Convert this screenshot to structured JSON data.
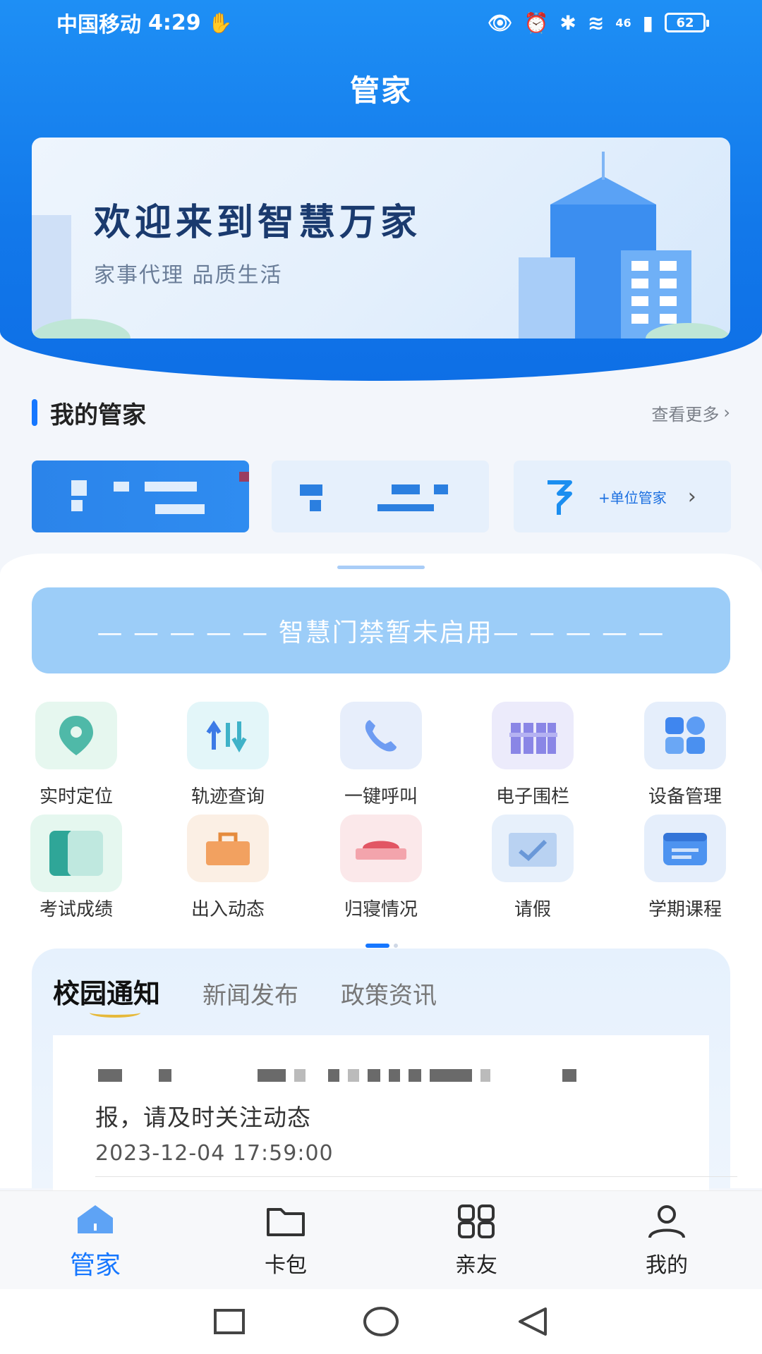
{
  "status": {
    "carrier": "中国移动",
    "time": "4:29",
    "network": "46",
    "battery": "62"
  },
  "header": {
    "title": "管家"
  },
  "banner": {
    "title": "欢迎来到智慧万家",
    "subtitle": "家事代理  品质生活"
  },
  "butler": {
    "title": "我的管家",
    "more": "查看更多",
    "add_unit": "+单位管家"
  },
  "door": {
    "text": "— — — — — 智慧门禁暂未启用— — — — —"
  },
  "grid": {
    "items": [
      {
        "label": "实时定位",
        "icon": "location-pin-icon"
      },
      {
        "label": "轨迹查询",
        "icon": "track-arrows-icon"
      },
      {
        "label": "一键呼叫",
        "icon": "phone-icon"
      },
      {
        "label": "电子围栏",
        "icon": "fence-icon"
      },
      {
        "label": "设备管理",
        "icon": "devices-icon"
      },
      {
        "label": "考试成绩",
        "icon": "exam-card-icon"
      },
      {
        "label": "出入动态",
        "icon": "bag-icon"
      },
      {
        "label": "归寝情况",
        "icon": "bed-icon"
      },
      {
        "label": "请假",
        "icon": "leave-icon"
      },
      {
        "label": "学期课程",
        "icon": "course-icon"
      }
    ]
  },
  "notice": {
    "tabs": [
      "校园通知",
      "新闻发布",
      "政策资讯"
    ],
    "item_text": "报，请及时关注动态",
    "item_time": "2023-12-04 17:59:00"
  },
  "nav": {
    "items": [
      {
        "label": "管家",
        "active": true
      },
      {
        "label": "卡包",
        "active": false
      },
      {
        "label": "亲友",
        "active": false
      },
      {
        "label": "我的",
        "active": false
      }
    ]
  },
  "colors": {
    "primary": "#1677ff",
    "header_blue": "#1278ea",
    "door_banner": "#9ccdf8"
  }
}
